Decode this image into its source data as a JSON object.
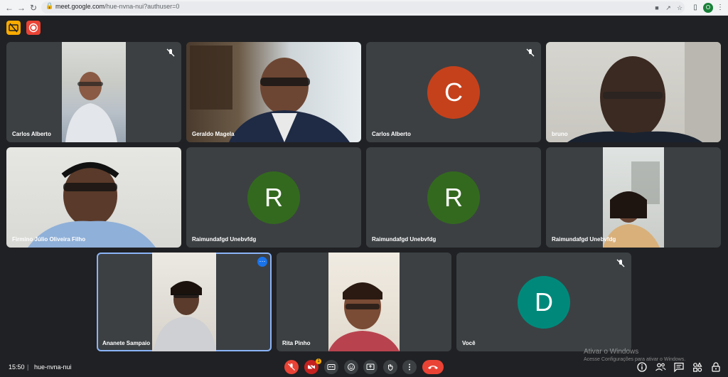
{
  "browser": {
    "url_host": "meet.google.com",
    "url_path": "/hue-nvna-nui?authuser=0",
    "profile_initial": "O"
  },
  "tiles": [
    {
      "name": "Carlos Alberto",
      "type": "video",
      "muted": true
    },
    {
      "name": "Geraldo Magela",
      "type": "video",
      "muted": false
    },
    {
      "name": "Carlos Alberto",
      "type": "avatar",
      "letter": "C",
      "color": "#c5411b",
      "muted": true
    },
    {
      "name": "bruno",
      "type": "video",
      "muted": false
    },
    {
      "name": "Firmino Júlio Oliveira Filho",
      "type": "video",
      "muted": false
    },
    {
      "name": "Raimundafgd Unebvfdg",
      "type": "avatar",
      "letter": "R",
      "color": "#33691e",
      "muted": false
    },
    {
      "name": "Raimundafgd Unebvfdg",
      "type": "avatar",
      "letter": "R",
      "color": "#33691e",
      "muted": false
    },
    {
      "name": "Raimundafgd Unebvfdg",
      "type": "video",
      "muted": false
    },
    {
      "name": "Ananete Sampaio",
      "type": "video",
      "muted": false,
      "selected": true
    },
    {
      "name": "Rita Pinho",
      "type": "video",
      "muted": false
    },
    {
      "name": "Você",
      "type": "avatar",
      "letter": "D",
      "color": "#00897b",
      "muted": true
    }
  ],
  "bottom": {
    "time": "15:50",
    "separator": "|",
    "meeting_code": "hue-nvna-nui",
    "notification_count": "1"
  },
  "watermark": {
    "line1": "Ativar o Windows",
    "line2": "Acesse Configurações para ativar o Windows."
  },
  "colors": {
    "background": "#202124",
    "tile": "#3c4043",
    "end_call": "#ea4335",
    "accent": "#8ab4f8"
  }
}
